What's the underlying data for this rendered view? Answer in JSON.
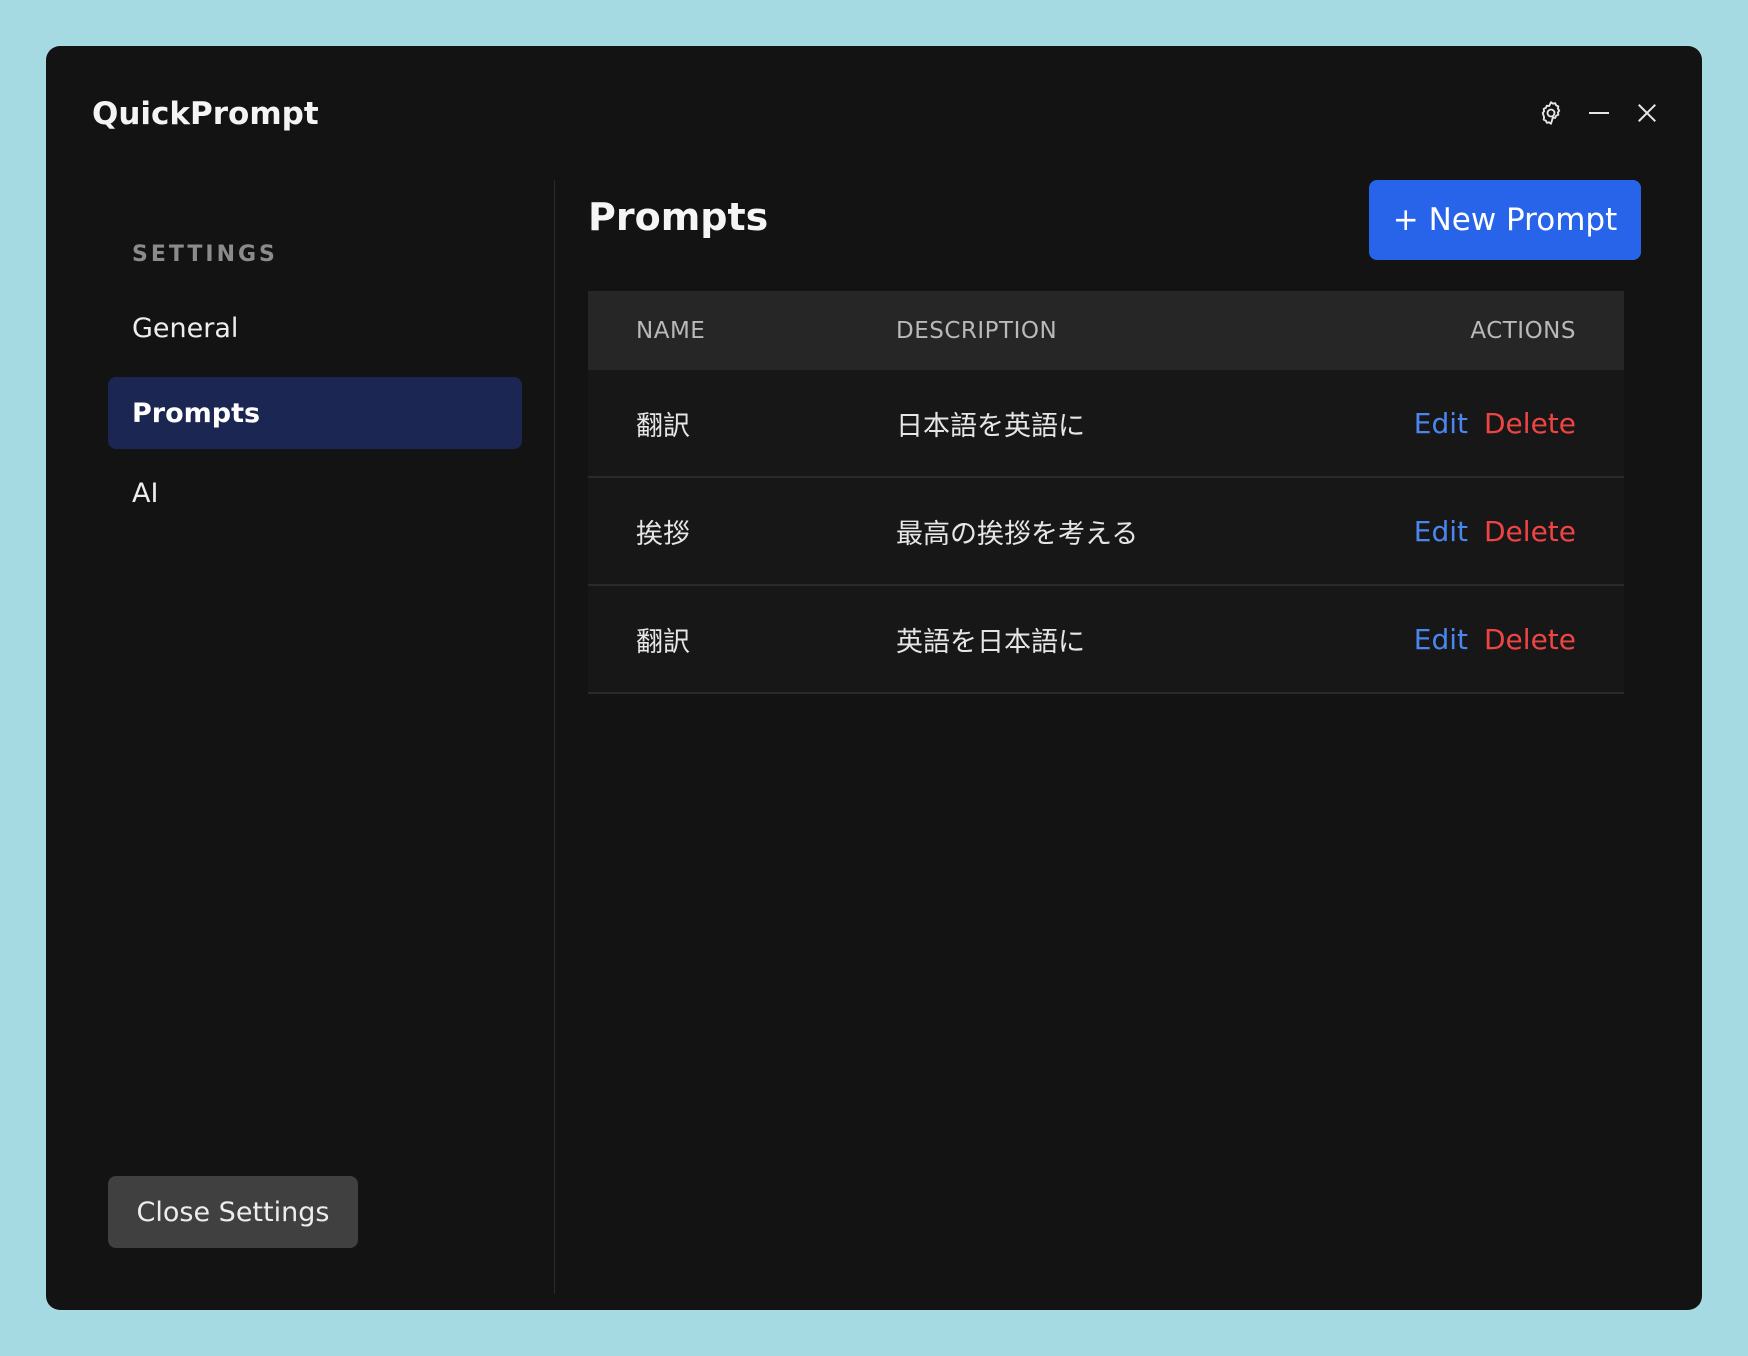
{
  "app": {
    "title": "QuickPrompt"
  },
  "title_controls": {
    "icons": [
      "gear-icon",
      "minimize-icon",
      "close-icon"
    ]
  },
  "sidebar": {
    "heading": "SETTINGS",
    "items": [
      {
        "label": "General",
        "active": false
      },
      {
        "label": "Prompts",
        "active": true
      },
      {
        "label": "AI",
        "active": false
      }
    ],
    "close_button": "Close Settings"
  },
  "main": {
    "title": "Prompts",
    "new_button": "+ New Prompt",
    "table": {
      "headers": {
        "name": "NAME",
        "description": "DESCRIPTION",
        "actions": "ACTIONS"
      },
      "rows": [
        {
          "name": "翻訳",
          "description": "日本語を英語に",
          "edit": "Edit",
          "delete": "Delete"
        },
        {
          "name": "挨拶",
          "description": "最高の挨拶を考える",
          "edit": "Edit",
          "delete": "Delete"
        },
        {
          "name": "翻訳",
          "description": "英語を日本語に",
          "edit": "Edit",
          "delete": "Delete"
        }
      ]
    }
  },
  "colors": {
    "background": "#a6dae2",
    "window": "#131313",
    "accent": "#2864ea",
    "active_nav": "#1b2652",
    "edit": "#4a86f0",
    "delete": "#ef4444"
  }
}
